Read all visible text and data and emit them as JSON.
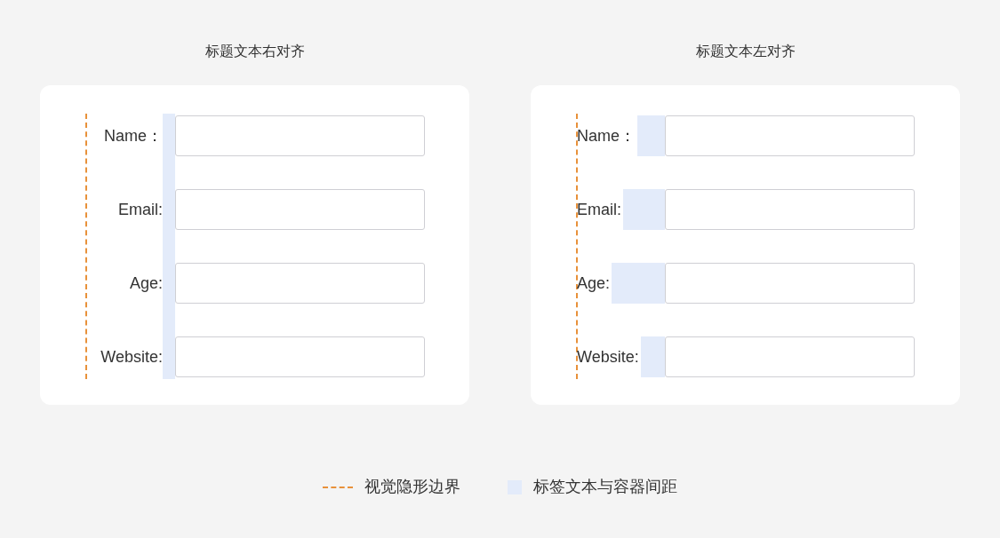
{
  "panels": [
    {
      "title": "标题文本右对齐",
      "kind": "right",
      "fields": [
        {
          "label": "Name："
        },
        {
          "label": "Email:"
        },
        {
          "label": "Age:"
        },
        {
          "label": "Website:"
        }
      ]
    },
    {
      "title": "标题文本左对齐",
      "kind": "left",
      "fields": [
        {
          "label": "Name："
        },
        {
          "label": "Email:"
        },
        {
          "label": "Age:"
        },
        {
          "label": "Website:"
        }
      ]
    }
  ],
  "legend": [
    {
      "kind": "boundary",
      "label": "视觉隐形边界"
    },
    {
      "kind": "spacing",
      "label": "标签文本与容器间距"
    }
  ]
}
